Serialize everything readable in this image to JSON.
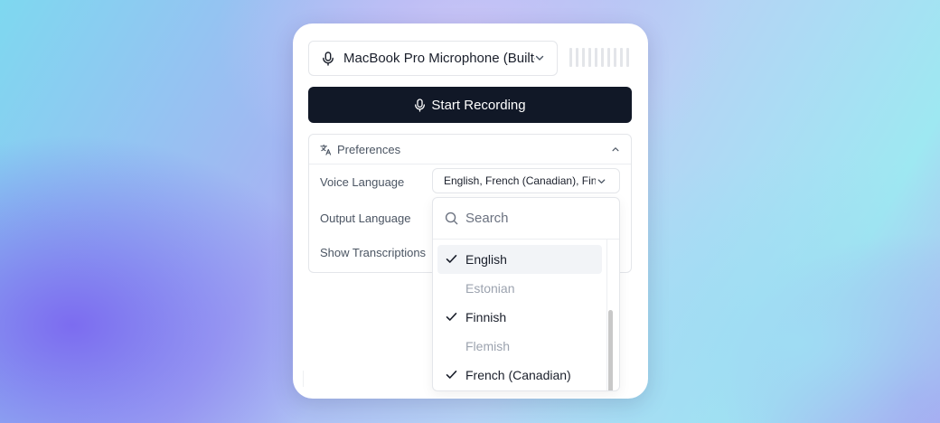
{
  "recorder": {
    "microphone": "MacBook Pro Microphone (Built-in)",
    "start_label": "Start Recording"
  },
  "preferences": {
    "title": "Preferences",
    "voice_language_label": "Voice Language",
    "voice_language_value": "English, French (Canadian), Finnish",
    "output_language_label": "Output Language",
    "show_transcriptions_label": "Show Transcriptions"
  },
  "dropdown": {
    "search_placeholder": "Search",
    "options": [
      {
        "label": "English",
        "checked": true,
        "highlighted": true,
        "disabled": false
      },
      {
        "label": "Estonian",
        "checked": false,
        "highlighted": false,
        "disabled": true
      },
      {
        "label": "Finnish",
        "checked": true,
        "highlighted": false,
        "disabled": false
      },
      {
        "label": "Flemish",
        "checked": false,
        "highlighted": false,
        "disabled": true
      },
      {
        "label": "French (Canadian)",
        "checked": true,
        "highlighted": false,
        "disabled": false
      }
    ]
  },
  "icons": {
    "microphone": "microphone-icon",
    "chevron": "chevron-down-icon",
    "translate": "translate-icon",
    "search": "search-icon",
    "check": "check-icon"
  },
  "colors": {
    "primary_button": "#111827",
    "text": "#1a1f2b",
    "muted_text": "#4b5563",
    "disabled_text": "#9ca3af"
  }
}
